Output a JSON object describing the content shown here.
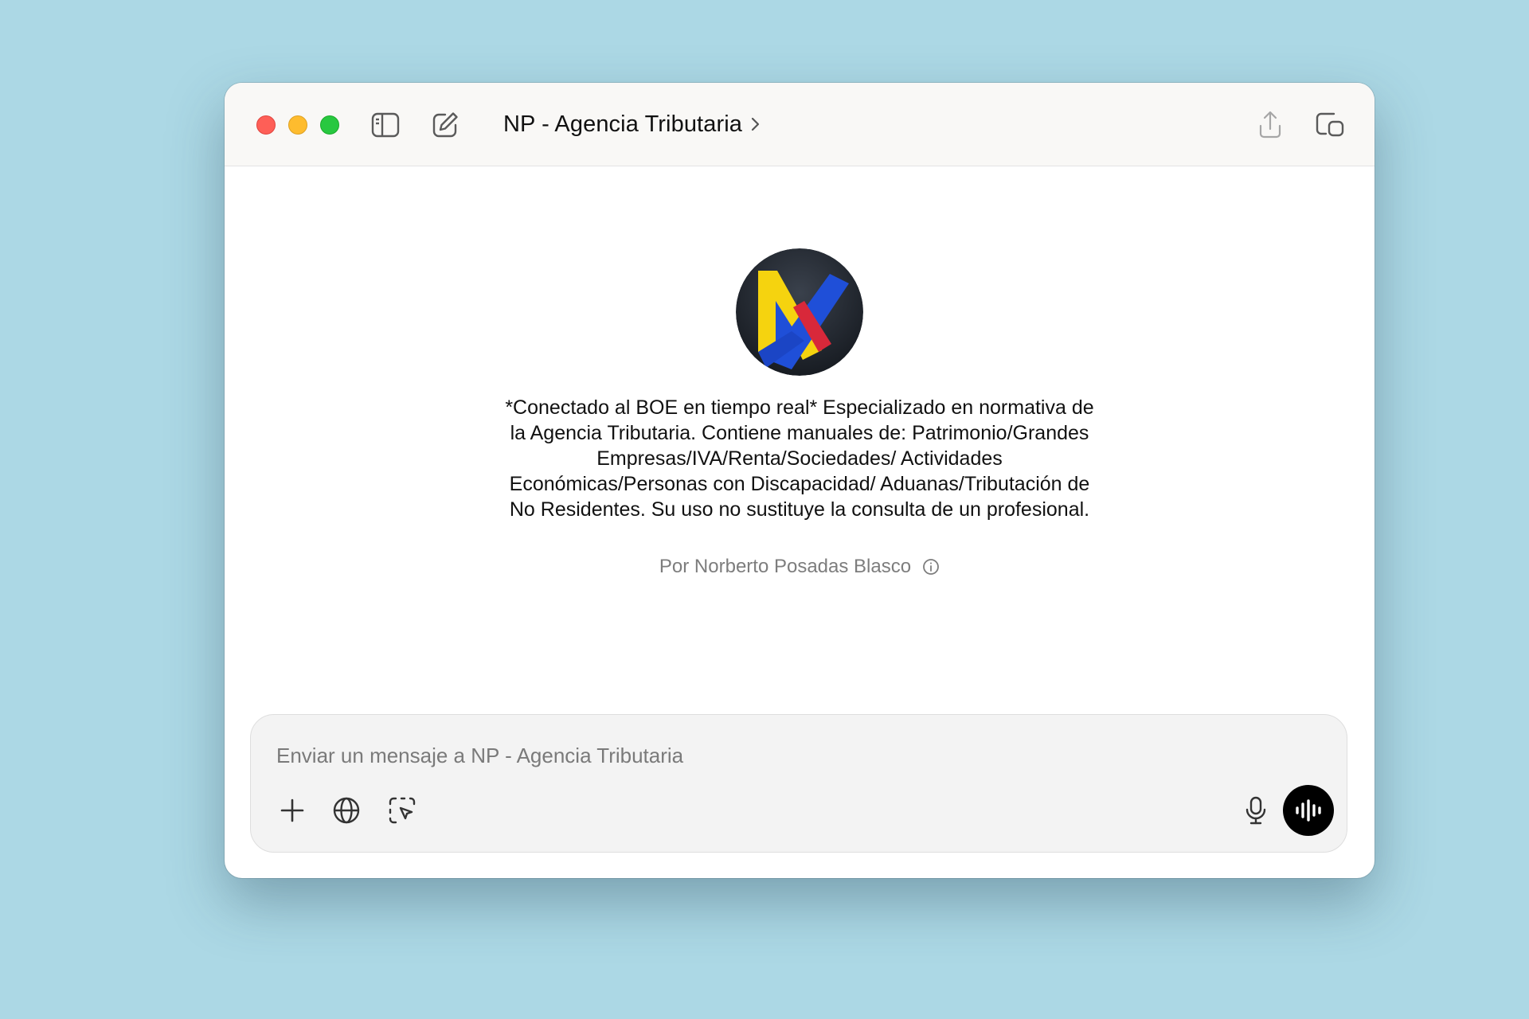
{
  "window": {
    "title": "NP - Agencia Tributaria"
  },
  "titlebar": {
    "icons": [
      "sidebar-toggle-icon",
      "new-chat-icon",
      "chevron-right-icon",
      "share-icon",
      "new-window-icon"
    ]
  },
  "gpt": {
    "logo": "np-logo",
    "description": "*Conectado al BOE en tiempo real* Especializado en normativa de la Agencia Tributaria. Contiene manuales de: Patrimonio/Grandes Empresas/IVA/Renta/Sociedades/ Actividades Económicas/Personas con Discapacidad/ Aduanas/Tributación de No Residentes. Su uso no sustituye la consulta de un profesional.",
    "author": "Por Norberto Posadas Blasco"
  },
  "composer": {
    "placeholder": "Enviar un mensaje a NP - Agencia Tributaria",
    "icons": [
      "plus-icon",
      "globe-icon",
      "select-region-icon",
      "microphone-icon",
      "voice-waveform-icon"
    ]
  },
  "colors": {
    "background": "#acd8e5",
    "close": "#fe5f57",
    "minimize": "#febc2e",
    "maximize": "#28c840",
    "logo_yellow": "#f5d30f",
    "logo_blue": "#1f4fd8",
    "logo_red": "#d8283a"
  }
}
